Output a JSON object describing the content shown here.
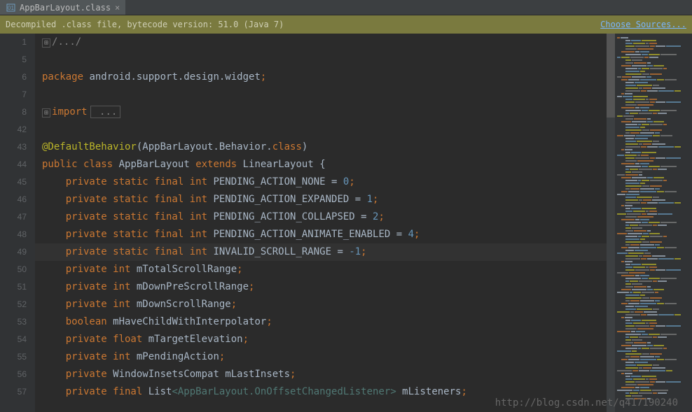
{
  "tab": {
    "title": "AppBarLayout.class",
    "icon": "class-icon"
  },
  "infoBar": {
    "message": "Decompiled .class file, bytecode version: 51.0 (Java 7)",
    "link": "Choose Sources..."
  },
  "gutter": [
    "1",
    "5",
    "6",
    "7",
    "8",
    "42",
    "43",
    "44",
    "45",
    "46",
    "47",
    "48",
    "49",
    "50",
    "51",
    "52",
    "53",
    "54",
    "55",
    "56",
    "57"
  ],
  "code": {
    "l0_fold": "/.../",
    "l2_kw": "package",
    "l2_rest": " android.support.design.widget",
    "l2_semi": ";",
    "l4_kw": "import",
    "l4_fold": " ...",
    "l6_ann": "@DefaultBehavior",
    "l6_paren1": "(AppBarLayout.Behavior.",
    "l6_cls": "class",
    "l6_paren2": ")",
    "l7_pub": "public",
    "l7_cls": "class",
    "l7_name": " AppBarLayout ",
    "l7_ext": "extends",
    "l7_sup": " LinearLayout {",
    "l8_mods": "private static final int",
    "l8_name": " PENDING_ACTION_NONE = ",
    "l8_val": "0",
    "l8_semi": ";",
    "l9_mods": "private static final int",
    "l9_name": " PENDING_ACTION_EXPANDED = ",
    "l9_val": "1",
    "l9_semi": ";",
    "l10_mods": "private static final int",
    "l10_name": " PENDING_ACTION_COLLAPSED = ",
    "l10_val": "2",
    "l10_semi": ";",
    "l11_mods": "private static final int",
    "l11_name": " PENDING_ACTION_ANIMATE_ENABLED = ",
    "l11_val": "4",
    "l11_semi": ";",
    "l12_mods": "private static final int",
    "l12_name": " INVALID_SCROLL_RANGE = ",
    "l12_val": "-1",
    "l12_semi": ";",
    "l13_mods": "private int",
    "l13_name": " mTotalScrollRange",
    "l13_semi": ";",
    "l14_mods": "private int",
    "l14_name": " mDownPreScrollRange",
    "l14_semi": ";",
    "l15_mods": "private int",
    "l15_name": " mDownScrollRange",
    "l15_semi": ";",
    "l16_mods": "boolean",
    "l16_name": " mHaveChildWithInterpolator",
    "l16_semi": ";",
    "l17_mods": "private float",
    "l17_name": " mTargetElevation",
    "l17_semi": ";",
    "l18_mods": "private int",
    "l18_name": " mPendingAction",
    "l18_semi": ";",
    "l19_mods": "private",
    "l19_type": " WindowInsetsCompat",
    "l19_name": " mLastInsets",
    "l19_semi": ";",
    "l20_mods": "private final",
    "l20_type": " List",
    "l20_gen": "<AppBarLayout.OnOffsetChangedListener>",
    "l20_name": " mListeners",
    "l20_semi": ";"
  },
  "watermark": "http://blog.csdn.net/q417190240"
}
